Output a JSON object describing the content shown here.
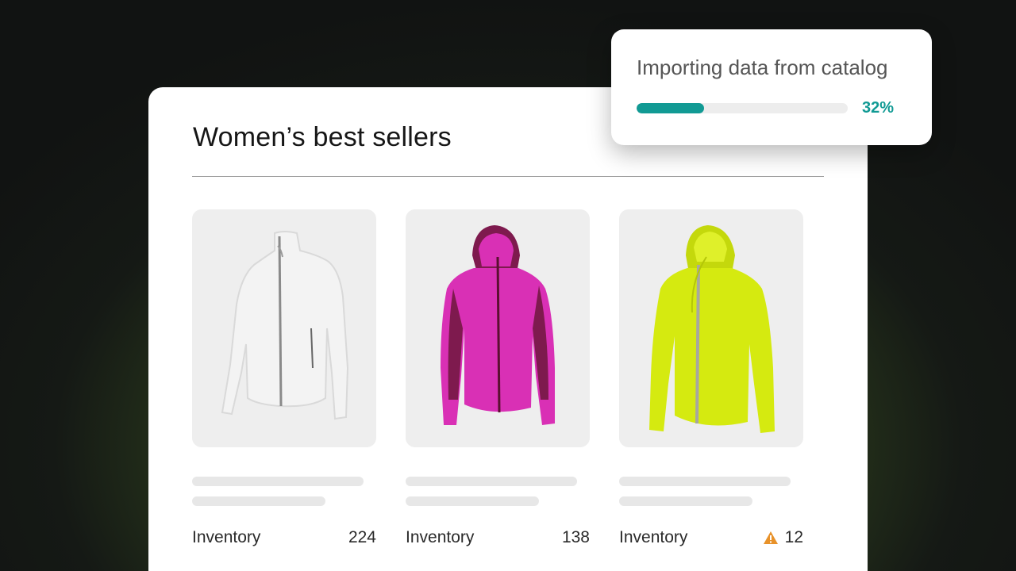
{
  "panel": {
    "title": "Women’s best sellers"
  },
  "products": [
    {
      "image": "white-jacket",
      "color": "#ececec",
      "accent": "#d6d6d6",
      "inventory_label": "Inventory",
      "inventory_value": "224",
      "warning": false
    },
    {
      "image": "magenta-jacket",
      "color": "#d930b5",
      "accent": "#7e1a4e",
      "inventory_label": "Inventory",
      "inventory_value": "138",
      "warning": false
    },
    {
      "image": "lime-jacket",
      "color": "#d5ea10",
      "accent": "#a9bb08",
      "inventory_label": "Inventory",
      "inventory_value": "12",
      "warning": true
    }
  ],
  "import_toast": {
    "title": "Importing data from catalog",
    "progress_percent": 32,
    "progress_label": "32%"
  },
  "colors": {
    "accent": "#119a94",
    "warning": "#e8922a"
  }
}
